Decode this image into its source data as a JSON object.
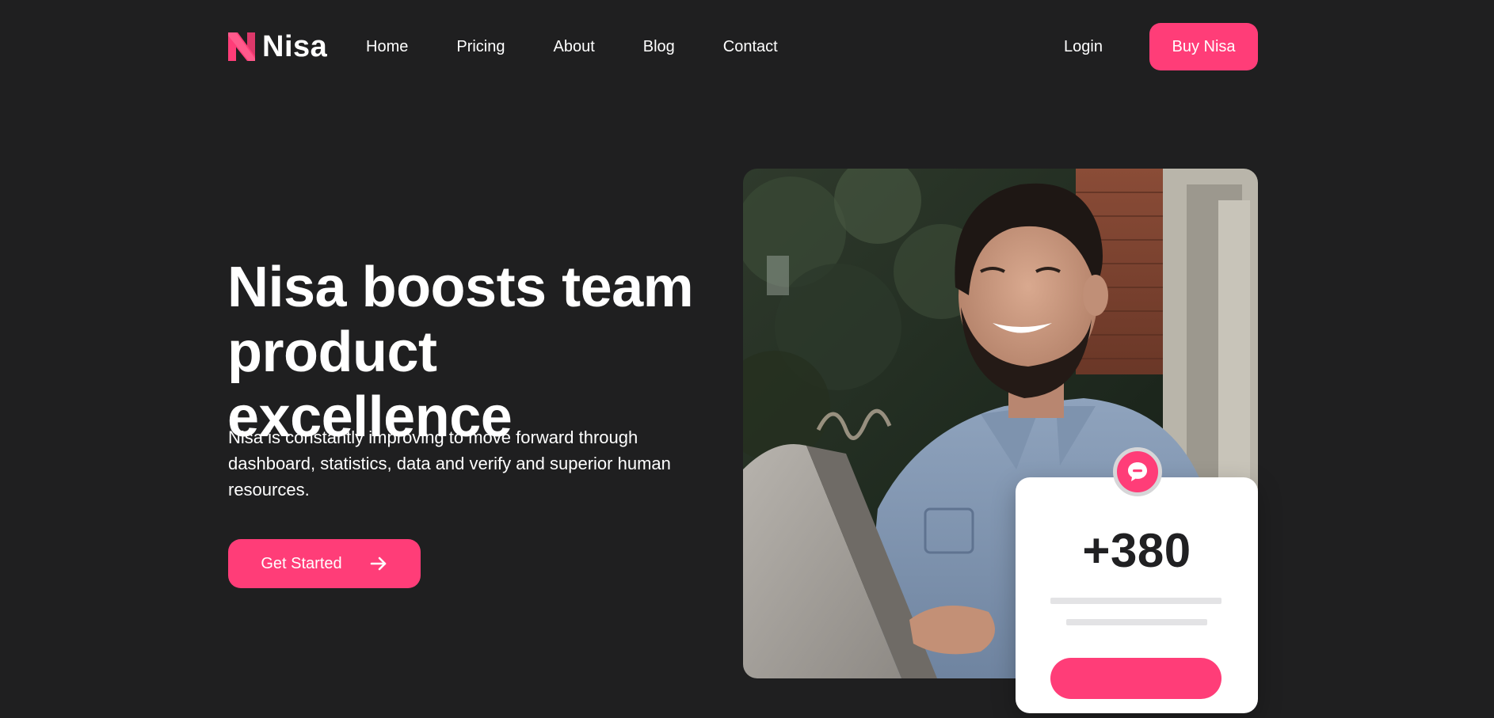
{
  "brand": {
    "name": "Nisa",
    "accent_color": "#ff3d78",
    "background_color": "#1f1f20",
    "logo_icon": "nisa-n-logo-icon"
  },
  "nav": {
    "items": [
      {
        "label": "Home"
      },
      {
        "label": "Pricing"
      },
      {
        "label": "About"
      },
      {
        "label": "Blog"
      },
      {
        "label": "Contact"
      }
    ],
    "login_label": "Login",
    "buy_label": "Buy Nisa"
  },
  "hero": {
    "title_line1": "Nisa boosts team",
    "title_line2": "product excellence",
    "subtitle": "Nisa is constantly improving to move forward through dashboard, statistics, data and verify and superior human resources.",
    "cta_label": "Get Started",
    "cta_icon": "arrow-right-icon",
    "image_subject": "smiling man with beard in denim shirt working on laptop"
  },
  "stat_card": {
    "value": "+380",
    "badge_icon": "chat-bubble-icon"
  }
}
